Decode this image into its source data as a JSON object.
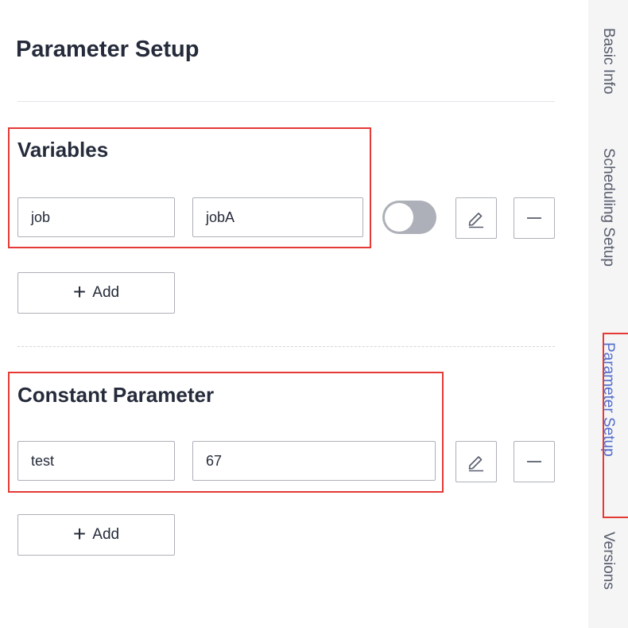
{
  "page": {
    "title": "Parameter Setup"
  },
  "variables": {
    "title": "Variables",
    "rows": [
      {
        "name": "job",
        "value": "jobA",
        "enabled": false
      }
    ],
    "add_label": "Add"
  },
  "constants": {
    "title": "Constant Parameter",
    "rows": [
      {
        "name": "test",
        "value": "67"
      }
    ],
    "add_label": "Add"
  },
  "side_nav": {
    "items": [
      {
        "label": "Basic Info",
        "active": false
      },
      {
        "label": "Scheduling Setup",
        "active": false
      },
      {
        "label": "Parameter Setup",
        "active": true
      },
      {
        "label": "Versions",
        "active": false
      }
    ]
  },
  "colors": {
    "accent": "#526ecc",
    "highlight": "#e53935",
    "border": "#adb0b8",
    "text": "#252b3a"
  },
  "icons": {
    "edit": "pencil-icon",
    "remove": "minus-icon",
    "add": "plus-icon"
  }
}
